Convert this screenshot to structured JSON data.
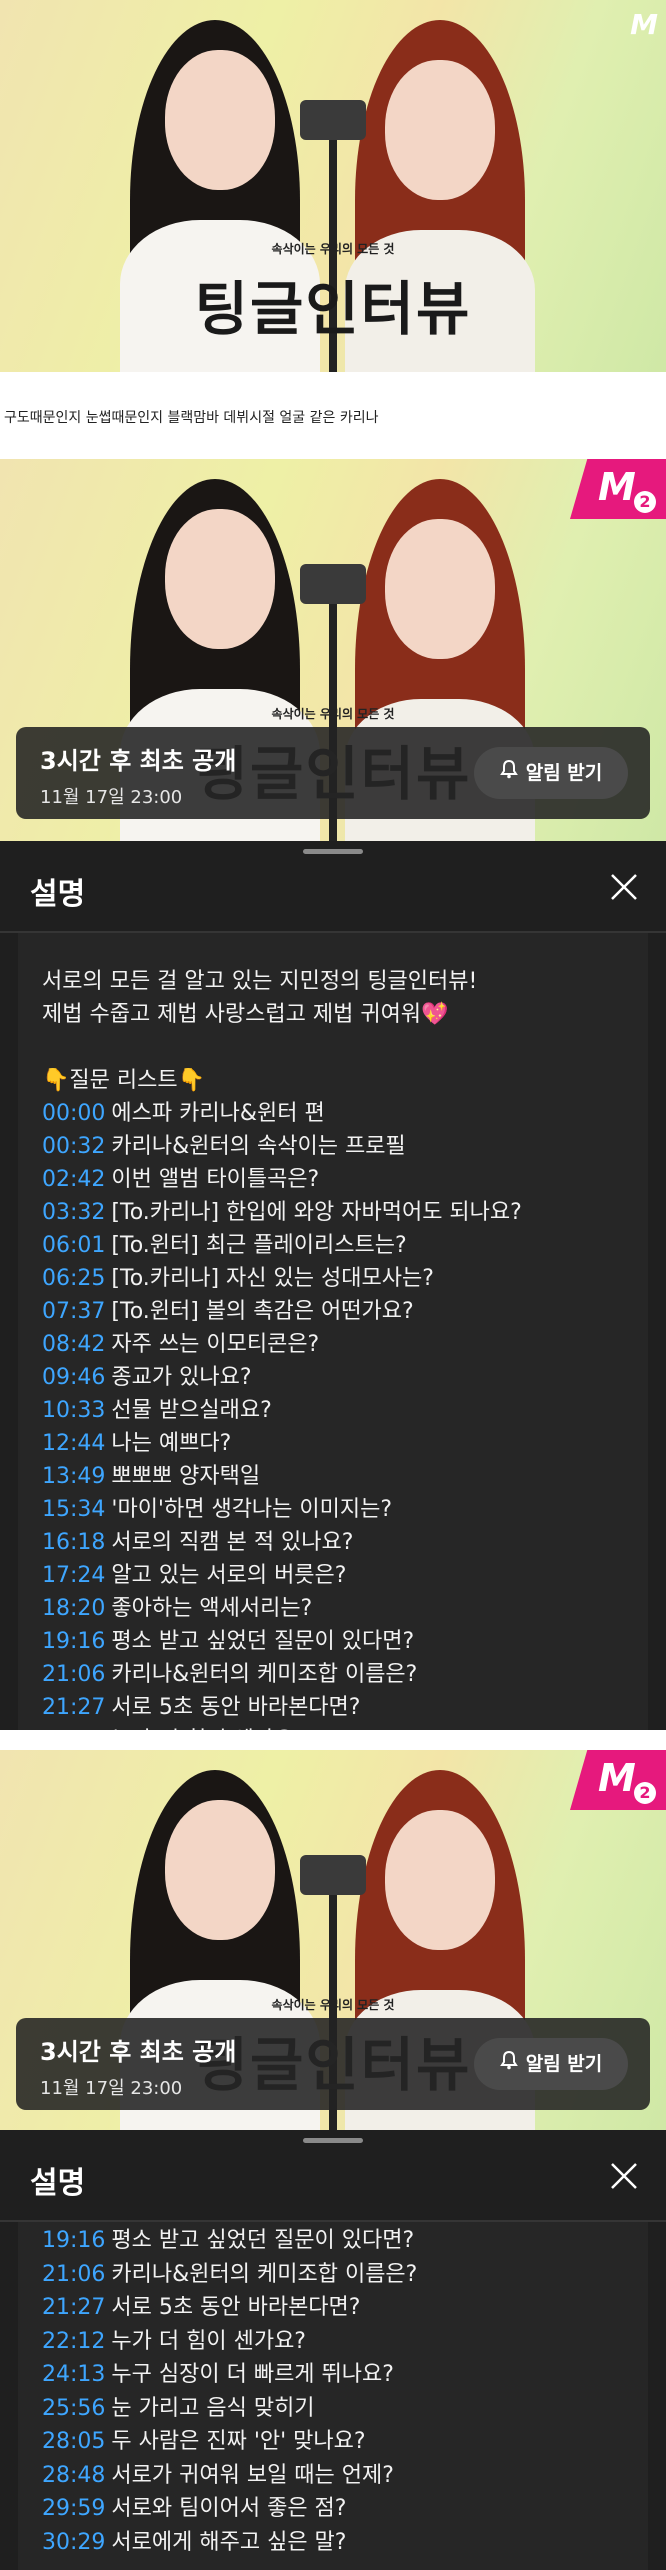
{
  "hero_top": {
    "title_art": "팅글인터뷰",
    "sub_art": "속삭이는 우리의 모든 것",
    "logo": "M"
  },
  "caption": "구도때문인지 눈썹때문인지 블랙맘바 데뷔시절 얼굴 같은 카리나",
  "channel_logo": {
    "letter": "M",
    "badge": "2"
  },
  "premiere": {
    "title": "3시간 후 최초 공개",
    "date": "11월 17일 23:00",
    "alarm_label": "알림 받기"
  },
  "panel": {
    "title": "설명"
  },
  "description": {
    "intro": [
      "서로의 모든 걸 알고 있는 지민정의 팅글인터뷰!",
      "제법 수줍고 제법 사랑스럽고 제법 귀여워💖"
    ],
    "list_header": "👇질문 리스트👇",
    "chapters": [
      {
        "t": "00:00",
        "label": "에스파 카리나&윈터 편"
      },
      {
        "t": "00:32",
        "label": "카리나&윈터의 속삭이는 프로필"
      },
      {
        "t": "02:42",
        "label": "이번 앨범 타이틀곡은?"
      },
      {
        "t": "03:32",
        "label": "[To.카리나] 한입에 와앙 자바먹어도 되나요?"
      },
      {
        "t": "06:01",
        "label": "[To.윈터] 최근 플레이리스트는?"
      },
      {
        "t": "06:25",
        "label": "[To.카리나] 자신 있는 성대모사는?"
      },
      {
        "t": "07:37",
        "label": "[To.윈터] 볼의 촉감은 어떤가요?"
      },
      {
        "t": "08:42",
        "label": "자주 쓰는 이모티콘은?"
      },
      {
        "t": "09:46",
        "label": "종교가 있나요?"
      },
      {
        "t": "10:33",
        "label": "선물 받으실래요?"
      },
      {
        "t": "12:44",
        "label": "나는 예쁘다?"
      },
      {
        "t": "13:49",
        "label": "뽀뽀뽀 양자택일"
      },
      {
        "t": "15:34",
        "label": "'마이'하면 생각나는 이미지는?"
      },
      {
        "t": "16:18",
        "label": "서로의 직캠 본 적 있나요?"
      },
      {
        "t": "17:24",
        "label": "알고 있는 서로의 버릇은?"
      },
      {
        "t": "18:20",
        "label": "좋아하는 액세서리는?"
      },
      {
        "t": "19:16",
        "label": "평소 받고 싶었던 질문이 있다면?"
      },
      {
        "t": "21:06",
        "label": "카리나&윈터의 케미조합 이름은?"
      },
      {
        "t": "21:27",
        "label": "서로 5초 동안 바라본다면?"
      },
      {
        "t": "22:12",
        "label": "누가 더 힘이 센가요?"
      },
      {
        "t": "24:13",
        "label": "누구 심장이 더 빠르게 뛰나요?"
      },
      {
        "t": "25:56",
        "label": "눈 가리고 음식 맞히기"
      },
      {
        "t": "28:05",
        "label": "두 사람은 진짜 '안' 맞나요?"
      },
      {
        "t": "28:48",
        "label": "서로가 귀여워 보일 때는 언제?"
      },
      {
        "t": "29:59",
        "label": "서로와 팀이어서 좋은 점?"
      },
      {
        "t": "30:29",
        "label": "서로에게 해주고 싶은 말?"
      }
    ]
  },
  "colors": {
    "timestamp": "#3ea6ff",
    "brand_pink": "#e6197d",
    "panel_bg": "#1f1f1f"
  }
}
